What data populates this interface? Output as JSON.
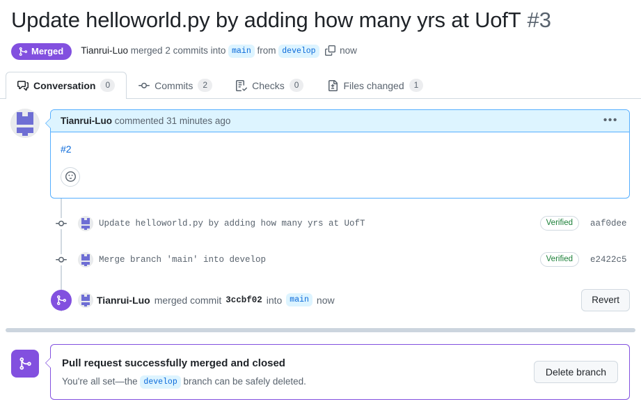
{
  "header": {
    "title": "Update helloworld.py by adding how many yrs at UofT",
    "number": "#3",
    "state_badge": "Merged",
    "state_color": "#8250df",
    "author": "Tianrui-Luo",
    "merged_text_1": "merged 2 commits into",
    "base_branch": "main",
    "from_text": "from",
    "head_branch": "develop",
    "time": "now",
    "copy_icon": "copy-icon",
    "merge_icon": "git-merge-icon"
  },
  "tabs": [
    {
      "label": "Conversation",
      "count": "0",
      "icon": "comment-discussion-icon",
      "selected": true
    },
    {
      "label": "Commits",
      "count": "2",
      "icon": "git-commit-icon",
      "selected": false
    },
    {
      "label": "Checks",
      "count": "0",
      "icon": "checklist-icon",
      "selected": false
    },
    {
      "label": "Files changed",
      "count": "1",
      "icon": "file-diff-icon",
      "selected": false
    }
  ],
  "comment": {
    "author": "Tianrui-Luo",
    "action": "commented",
    "time": "31 minutes ago",
    "body_link": "#2",
    "menu_icon": "kebab-horizontal-icon",
    "reaction_icon": "smiley-icon",
    "header_bg": "#ddf4ff",
    "border_color": "#54aeff"
  },
  "commits": [
    {
      "message": "Update helloworld.py by adding how many yrs at UofT",
      "verified": "Verified",
      "sha": "aaf0dee",
      "node_icon": "git-commit-icon"
    },
    {
      "message": "Merge branch 'main' into develop",
      "verified": "Verified",
      "sha": "e2422c5",
      "node_icon": "git-commit-icon"
    }
  ],
  "merged_event": {
    "icon": "git-merge-icon",
    "author": "Tianrui-Luo",
    "action": "merged commit",
    "sha": "3ccbf02",
    "into": "into",
    "branch": "main",
    "time": "now",
    "revert_label": "Revert"
  },
  "merge_banner": {
    "icon": "git-merge-icon",
    "title": "Pull request successfully merged and closed",
    "subtitle_before": "You're all set—the",
    "branch": "develop",
    "subtitle_after": "branch can be safely deleted.",
    "button_label": "Delete branch",
    "accent_color": "#8250df"
  }
}
